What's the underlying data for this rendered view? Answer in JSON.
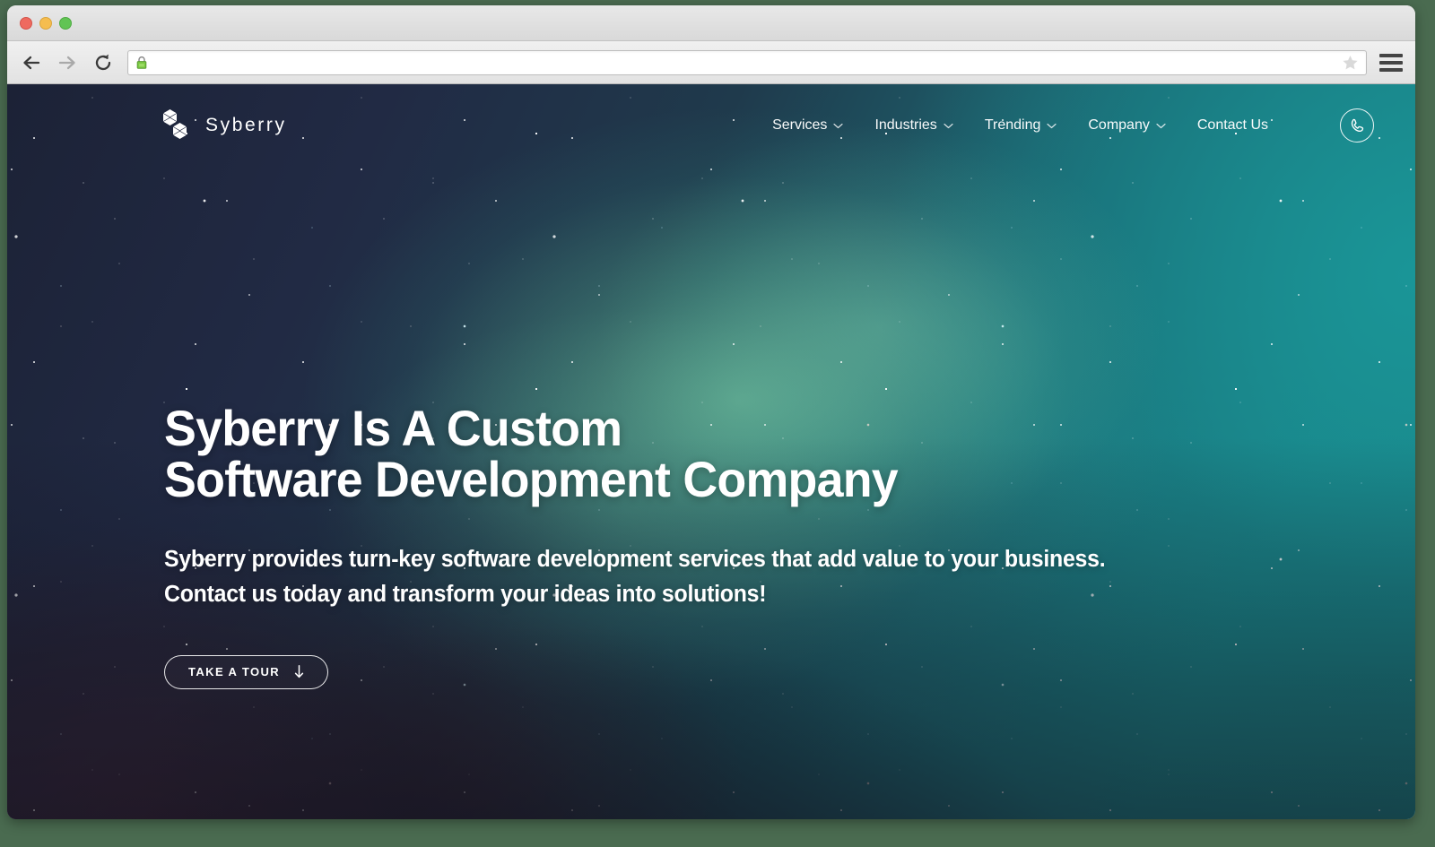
{
  "browser": {
    "traffic_lights": [
      "close",
      "minimize",
      "maximize"
    ],
    "back_icon": "back-arrow-icon",
    "forward_icon": "forward-arrow-icon",
    "reload_icon": "reload-icon",
    "lock_icon": "secure-lock-icon",
    "url": "",
    "url_placeholder": "",
    "bookmark_icon": "star-icon",
    "menu_icon": "hamburger-menu-icon",
    "colors": {
      "close": "#ee6a5f",
      "minimize": "#f5bd4f",
      "maximize": "#61c454",
      "lock_green": "#6cc24a",
      "toolbar_bg": "#e9e9e9"
    }
  },
  "site": {
    "brand": {
      "name": "Syberry",
      "logo_icon": "syberry-hexagon-logo"
    },
    "nav": {
      "items": [
        {
          "label": "Services",
          "has_dropdown": true
        },
        {
          "label": "Industries",
          "has_dropdown": true
        },
        {
          "label": "Trending",
          "has_dropdown": true
        },
        {
          "label": "Company",
          "has_dropdown": true
        },
        {
          "label": "Contact Us",
          "has_dropdown": false
        }
      ],
      "phone_button_icon": "phone-icon"
    },
    "hero": {
      "title": "Syberry Is A Custom\nSoftware Development Company",
      "subtitle": "Syberry provides turn-key software development services that add value to your business. Contact us today and transform your ideas into solutions!",
      "cta": {
        "label": "TAKE A TOUR",
        "icon": "arrow-down-icon"
      },
      "colors": {
        "text": "#ffffff",
        "bg_dark_navy": "#1c2236",
        "bg_teal": "#1a9190",
        "bg_purple": "#3e283a",
        "nebula_green": "#7ed6aa"
      }
    }
  },
  "page": {
    "background_color": "#4a6b50"
  }
}
